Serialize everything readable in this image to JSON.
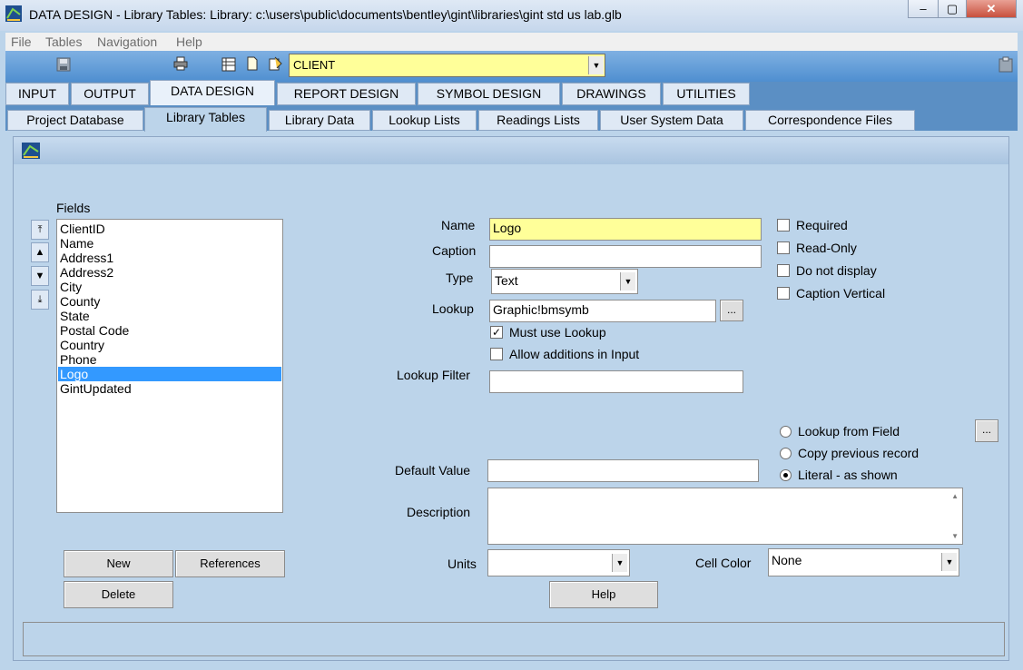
{
  "window": {
    "title": "DATA DESIGN -  Library Tables:  Library: c:\\users\\public\\documents\\bentley\\gint\\libraries\\gint std us lab.glb",
    "minimize": "–",
    "maximize": "▢",
    "close": "✕"
  },
  "menu": [
    "File",
    "Tables",
    "Navigation",
    "Help"
  ],
  "toolbar": {
    "table_select": "CLIENT"
  },
  "main_tabs": [
    "INPUT",
    "OUTPUT",
    "DATA DESIGN",
    "REPORT DESIGN",
    "SYMBOL DESIGN",
    "DRAWINGS",
    "UTILITIES"
  ],
  "sub_tabs": [
    "Project Database",
    "Library Tables",
    "Library Data",
    "Lookup Lists",
    "Readings Lists",
    "User System Data",
    "Correspondence Files"
  ],
  "fields": {
    "label": "Fields",
    "items": [
      "ClientID",
      "Name",
      "Address1",
      "Address2",
      "City",
      "County",
      "State",
      "Postal Code",
      "Country",
      "Phone",
      "Logo",
      "GintUpdated"
    ],
    "selected": "Logo"
  },
  "form": {
    "name_label": "Name",
    "name_value": "Logo",
    "caption_label": "Caption",
    "caption_value": "",
    "type_label": "Type",
    "type_value": "Text",
    "lookup_label": "Lookup",
    "lookup_value": "Graphic!bmsymb",
    "lookup_browse": "...",
    "must_use_lookup": "Must use Lookup",
    "allow_additions": "Allow additions in Input",
    "lookup_filter_label": "Lookup Filter",
    "default_value_label": "Default Value",
    "description_label": "Description",
    "units_label": "Units",
    "cell_color_label": "Cell Color",
    "cell_color_value": "None"
  },
  "checkboxes": [
    {
      "label": "Required",
      "checked": false
    },
    {
      "label": "Read-Only",
      "checked": false
    },
    {
      "label": "Do not display",
      "checked": false
    },
    {
      "label": "Caption Vertical",
      "checked": false
    }
  ],
  "default_source": {
    "options": [
      "Lookup from Field",
      "Copy previous record",
      "Literal - as shown"
    ],
    "selected": "Literal - as shown",
    "browse": "..."
  },
  "buttons": {
    "new": "New",
    "references": "References",
    "delete": "Delete",
    "help": "Help"
  },
  "checkmark": "✓",
  "colors": {
    "highlight": "#ffff99",
    "selection": "#3399ff",
    "tabbar": "#5b8fc4"
  }
}
